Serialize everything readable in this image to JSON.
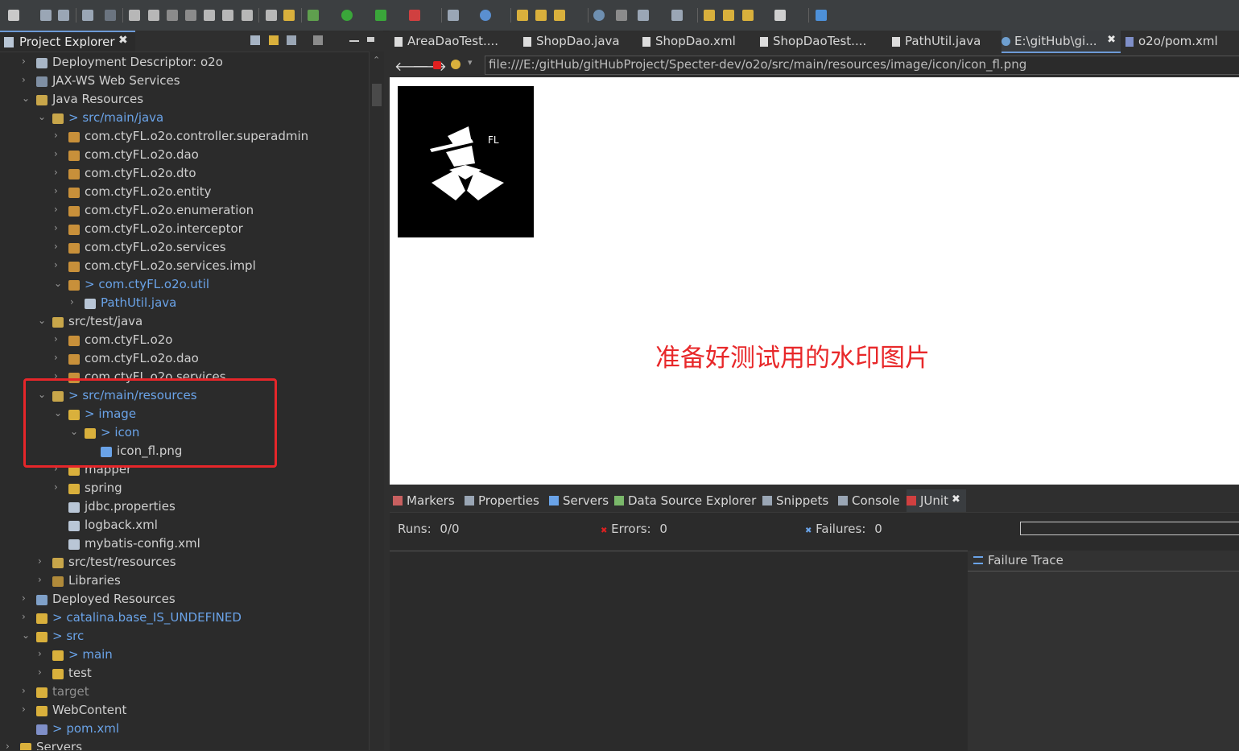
{
  "project_explorer": {
    "tab_title": "Project Explorer",
    "tree": [
      {
        "label": "Deployment Descriptor: o2o",
        "depth": 0,
        "state": "collapsed",
        "icon": "deployment-descriptor-icon",
        "style": "normal"
      },
      {
        "label": "JAX-WS Web Services",
        "depth": 0,
        "state": "collapsed",
        "icon": "web-services-icon",
        "style": "normal"
      },
      {
        "label": "Java Resources",
        "depth": 0,
        "state": "expanded",
        "icon": "java-resources-icon",
        "style": "normal"
      },
      {
        "label": "> src/main/java",
        "depth": 1,
        "state": "expanded",
        "icon": "source-folder-icon",
        "style": "blue"
      },
      {
        "label": "com.ctyFL.o2o.controller.superadmin",
        "depth": 2,
        "state": "collapsed",
        "icon": "package-icon",
        "style": "normal"
      },
      {
        "label": "com.ctyFL.o2o.dao",
        "depth": 2,
        "state": "collapsed",
        "icon": "package-icon",
        "style": "normal"
      },
      {
        "label": "com.ctyFL.o2o.dto",
        "depth": 2,
        "state": "collapsed",
        "icon": "package-icon",
        "style": "normal"
      },
      {
        "label": "com.ctyFL.o2o.entity",
        "depth": 2,
        "state": "collapsed",
        "icon": "package-icon",
        "style": "normal"
      },
      {
        "label": "com.ctyFL.o2o.enumeration",
        "depth": 2,
        "state": "collapsed",
        "icon": "package-icon",
        "style": "normal"
      },
      {
        "label": "com.ctyFL.o2o.interceptor",
        "depth": 2,
        "state": "collapsed",
        "icon": "package-icon",
        "style": "normal"
      },
      {
        "label": "com.ctyFL.o2o.services",
        "depth": 2,
        "state": "collapsed",
        "icon": "package-icon",
        "style": "normal"
      },
      {
        "label": "com.ctyFL.o2o.services.impl",
        "depth": 2,
        "state": "collapsed",
        "icon": "package-icon",
        "style": "normal"
      },
      {
        "label": "> com.ctyFL.o2o.util",
        "depth": 2,
        "state": "expanded",
        "icon": "package-icon",
        "style": "blue"
      },
      {
        "label": "PathUtil.java",
        "depth": 3,
        "state": "collapsed",
        "icon": "java-file-icon",
        "style": "blue"
      },
      {
        "label": "src/test/java",
        "depth": 1,
        "state": "expanded",
        "icon": "source-folder-icon",
        "style": "normal"
      },
      {
        "label": "com.ctyFL.o2o",
        "depth": 2,
        "state": "collapsed",
        "icon": "package-icon",
        "style": "normal"
      },
      {
        "label": "com.ctyFL.o2o.dao",
        "depth": 2,
        "state": "collapsed",
        "icon": "package-icon",
        "style": "normal"
      },
      {
        "label": "com.ctyFL.o2o.services",
        "depth": 2,
        "state": "collapsed",
        "icon": "package-icon",
        "style": "normal"
      },
      {
        "label": "> src/main/resources",
        "depth": 1,
        "state": "expanded",
        "icon": "source-folder-icon",
        "style": "blue"
      },
      {
        "label": "> image",
        "depth": 2,
        "state": "expanded",
        "icon": "folder-icon",
        "style": "blue"
      },
      {
        "label": "> icon",
        "depth": 3,
        "state": "expanded",
        "icon": "folder-icon",
        "style": "blue"
      },
      {
        "label": "icon_fl.png",
        "depth": 4,
        "state": "leaf",
        "icon": "image-file-icon",
        "style": "normal"
      },
      {
        "label": "mapper",
        "depth": 2,
        "state": "collapsed",
        "icon": "folder-icon",
        "style": "normal"
      },
      {
        "label": "spring",
        "depth": 2,
        "state": "collapsed",
        "icon": "folder-icon",
        "style": "normal"
      },
      {
        "label": "jdbc.properties",
        "depth": 2,
        "state": "leaf",
        "icon": "properties-file-icon",
        "style": "normal"
      },
      {
        "label": "logback.xml",
        "depth": 2,
        "state": "leaf",
        "icon": "xml-file-icon",
        "style": "normal"
      },
      {
        "label": "mybatis-config.xml",
        "depth": 2,
        "state": "leaf",
        "icon": "xml-file-icon",
        "style": "normal"
      },
      {
        "label": "src/test/resources",
        "depth": 1,
        "state": "collapsed",
        "icon": "source-folder-icon",
        "style": "normal"
      },
      {
        "label": "Libraries",
        "depth": 1,
        "state": "collapsed",
        "icon": "libraries-icon",
        "style": "normal"
      },
      {
        "label": "Deployed Resources",
        "depth": 0,
        "state": "collapsed",
        "icon": "deployed-resources-icon",
        "style": "normal"
      },
      {
        "label": "> catalina.base_IS_UNDEFINED",
        "depth": 0,
        "state": "collapsed",
        "icon": "folder-icon",
        "style": "blue"
      },
      {
        "label": "> src",
        "depth": 0,
        "state": "expanded",
        "icon": "folder-icon",
        "style": "blue"
      },
      {
        "label": "> main",
        "depth": 1,
        "state": "collapsed",
        "icon": "folder-icon",
        "style": "blue"
      },
      {
        "label": "test",
        "depth": 1,
        "state": "collapsed",
        "icon": "folder-icon",
        "style": "normal"
      },
      {
        "label": "target",
        "depth": 0,
        "state": "collapsed",
        "icon": "folder-icon",
        "style": "gray"
      },
      {
        "label": "WebContent",
        "depth": 0,
        "state": "collapsed",
        "icon": "folder-icon",
        "style": "normal"
      },
      {
        "label": "> pom.xml",
        "depth": 0,
        "state": "leaf",
        "icon": "maven-pom-icon",
        "style": "blue"
      },
      {
        "label": "Servers",
        "depth": -1,
        "state": "collapsed",
        "icon": "folder-icon",
        "style": "normal"
      }
    ]
  },
  "editor_tabs": [
    {
      "label": "AreaDaoTest....",
      "icon": "java-file-icon",
      "active": false
    },
    {
      "label": "ShopDao.java",
      "icon": "java-file-icon",
      "active": false
    },
    {
      "label": "ShopDao.xml",
      "icon": "xml-file-icon",
      "active": false
    },
    {
      "label": "ShopDaoTest....",
      "icon": "java-file-icon",
      "active": false
    },
    {
      "label": "PathUtil.java",
      "icon": "java-file-icon",
      "active": false
    },
    {
      "label": "E:\\gitHub\\gi...",
      "icon": "globe-icon",
      "active": true
    },
    {
      "label": "o2o/pom.xml",
      "icon": "maven-pom-icon",
      "active": false
    }
  ],
  "browser": {
    "url": "file:///E:/gitHub/gitHubProject/Specter-dev/o2o/src/main/resources/image/icon/icon_fl.png",
    "image_text": "FL",
    "caption": "准备好测试用的水印图片"
  },
  "bottom_tabs": [
    {
      "label": "Markers",
      "icon": "markers-icon"
    },
    {
      "label": "Properties",
      "icon": "properties-icon"
    },
    {
      "label": "Servers",
      "icon": "servers-icon"
    },
    {
      "label": "Data Source Explorer",
      "icon": "data-source-icon"
    },
    {
      "label": "Snippets",
      "icon": "snippets-icon"
    },
    {
      "label": "Console",
      "icon": "console-icon"
    },
    {
      "label": "JUnit",
      "icon": "junit-icon"
    }
  ],
  "junit": {
    "runs_label": "Runs:",
    "runs_value": "0/0",
    "errors_label": "Errors:",
    "errors_value": "0",
    "failures_label": "Failures:",
    "failures_value": "0",
    "failure_trace_label": "Failure Trace"
  },
  "colors": {
    "accent_blue": "#6aa3e8",
    "highlight_box": "#e6262a",
    "caption_red": "#e8282a"
  }
}
